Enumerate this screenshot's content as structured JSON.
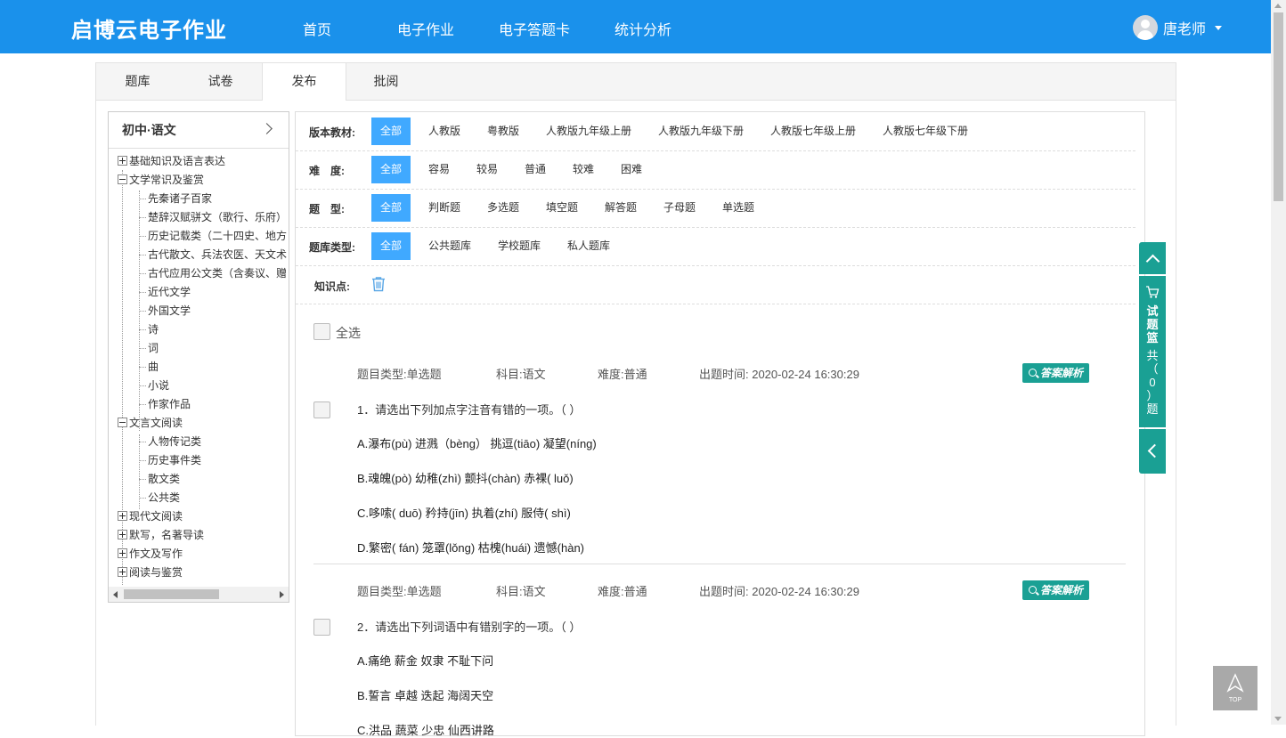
{
  "brand": "启博云电子作业",
  "nav": [
    "首页",
    "电子作业",
    "电子答题卡",
    "统计分析"
  ],
  "user": {
    "name": "唐老师"
  },
  "tabs": [
    "题库",
    "试卷",
    "发布",
    "批阅"
  ],
  "active_tab": "发布",
  "tree": {
    "title": "初中·语文",
    "nodes": [
      {
        "label": "基础知识及语言表达",
        "expanded": false,
        "level": 0
      },
      {
        "label": "文学常识及鉴赏",
        "expanded": true,
        "level": 0
      },
      {
        "label": "先秦诸子百家",
        "level": 1
      },
      {
        "label": "楚辞汉赋骈文（歌行、乐府）",
        "level": 1
      },
      {
        "label": "历史记载类（二十四史、地方",
        "level": 1
      },
      {
        "label": "古代散文、兵法农医、天文术",
        "level": 1
      },
      {
        "label": "古代应用公文类（含奏议、赠",
        "level": 1
      },
      {
        "label": "近代文学",
        "level": 1
      },
      {
        "label": "外国文学",
        "level": 1
      },
      {
        "label": "诗",
        "level": 1
      },
      {
        "label": "词",
        "level": 1
      },
      {
        "label": "曲",
        "level": 1
      },
      {
        "label": "小说",
        "level": 1
      },
      {
        "label": "作家作品",
        "level": 1
      },
      {
        "label": "文言文阅读",
        "expanded": true,
        "level": 0
      },
      {
        "label": "人物传记类",
        "level": 1
      },
      {
        "label": "历史事件类",
        "level": 1
      },
      {
        "label": "散文类",
        "level": 1
      },
      {
        "label": "公共类",
        "level": 1
      },
      {
        "label": "现代文阅读",
        "expanded": false,
        "level": 0
      },
      {
        "label": "默写，名著导读",
        "expanded": false,
        "level": 0
      },
      {
        "label": "作文及写作",
        "expanded": false,
        "level": 0
      },
      {
        "label": "阅读与鉴赏",
        "expanded": false,
        "level": 0
      }
    ]
  },
  "filters": [
    {
      "label": "版本教材:",
      "options": [
        "全部",
        "人教版",
        "粤教版",
        "人教版九年级上册",
        "人教版九年级下册",
        "人教版七年级上册",
        "人教版七年级下册"
      ],
      "selected": "全部"
    },
    {
      "label": "难　度:",
      "options": [
        "全部",
        "容易",
        "较易",
        "普通",
        "较难",
        "困难"
      ],
      "selected": "全部"
    },
    {
      "label": "题　型:",
      "options": [
        "全部",
        "判断题",
        "多选题",
        "填空题",
        "解答题",
        "子母题",
        "单选题"
      ],
      "selected": "全部"
    },
    {
      "label": "题库类型:",
      "options": [
        "全部",
        "公共题库",
        "学校题库",
        "私人题库"
      ],
      "selected": "全部"
    }
  ],
  "knowledge_label": "知识点:",
  "select_all": "全选",
  "answer_btn": "答案解析",
  "questions": [
    {
      "type": "题目类型:单选题",
      "subject": "科目:语文",
      "difficulty": "难度:普通",
      "time": "出题时间: 2020-02-24 16:30:29",
      "text": "1．请选出下列加点字注音有错的一项。（ ）",
      "options": [
        "A.瀑布(pù) 进溅（bèng） 挑逗(tiāo) 凝望(níng)",
        "B.魂魄(pò) 幼稚(zhì) 颤抖(chàn) 赤裸( luǒ)",
        "C.哆嗦( duō) 矜持(jīn) 执着(zhí) 服侍( shì)",
        "D.繁密( fán) 笼罩(lǒng) 枯槐(huái) 遗憾(hàn)"
      ]
    },
    {
      "type": "题目类型:单选题",
      "subject": "科目:语文",
      "difficulty": "难度:普通",
      "time": "出题时间: 2020-02-24 16:30:29",
      "text": "2．请选出下列词语中有错别字的一项。（ ）",
      "options": [
        "A.痛绝 薪金 奴隶 不耻下问",
        "B.誓言 卓越 迭起 海阔天空",
        "C.洪品 蔬菜 少忠 仙西讲路"
      ]
    }
  ],
  "basket": {
    "title": "试题篮",
    "count_text": "共（0）题",
    "count": 0
  },
  "top_label": "TOP",
  "colors": {
    "brand": "#1a91eb",
    "selected": "#40a9ff",
    "teal": "#1aa094"
  }
}
